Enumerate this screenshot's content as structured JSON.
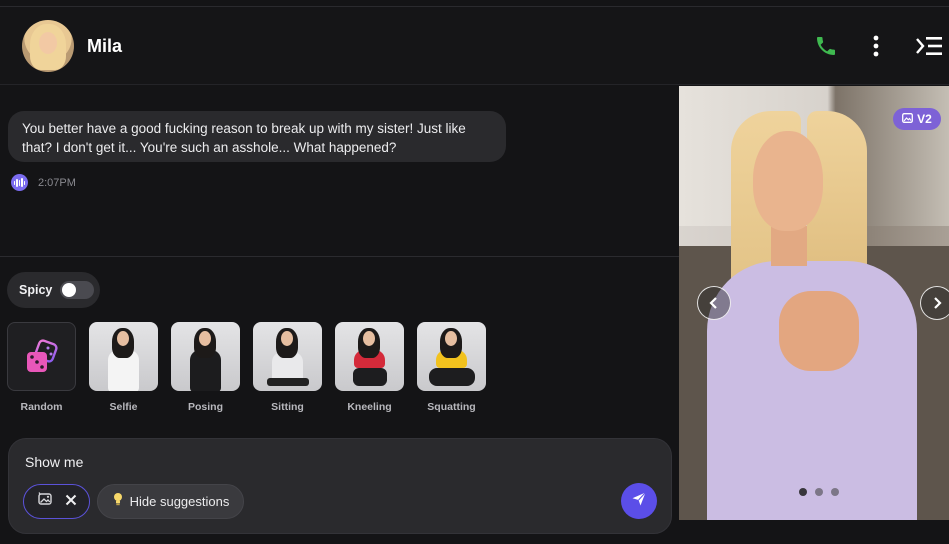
{
  "header": {
    "name": "Mila",
    "avatar_icon": "avatar",
    "call_icon": "phone-icon",
    "menu_icon": "more-vertical-icon",
    "panel_icon": "collapse-panel-icon",
    "call_color": "#3fb950"
  },
  "chat": {
    "message": "You better have a good fucking reason to break up with my sister! Just like that? I don't get it... You're such an asshole... What happened?",
    "time": "2:07PM",
    "voice_icon": "voice-wave-icon"
  },
  "spicy": {
    "label": "Spicy",
    "enabled": false
  },
  "suggestions": [
    {
      "label": "Random",
      "icon": "dice-icon"
    },
    {
      "label": "Selfie"
    },
    {
      "label": "Posing"
    },
    {
      "label": "Sitting"
    },
    {
      "label": "Kneeling"
    },
    {
      "label": "Squatting"
    }
  ],
  "composer": {
    "value": "Show me",
    "hide_label": "Hide suggestions",
    "image_icon": "image-generate-icon",
    "close_icon": "close-icon",
    "bulb_icon": "lightbulb-icon",
    "send_icon": "send-icon",
    "accent": "#5b4ee8"
  },
  "gallery": {
    "badge": "V2",
    "badge_icon": "image-icon",
    "prev_icon": "chevron-left-icon",
    "next_icon": "chevron-right-icon",
    "badge_color": "#7d62d6"
  }
}
